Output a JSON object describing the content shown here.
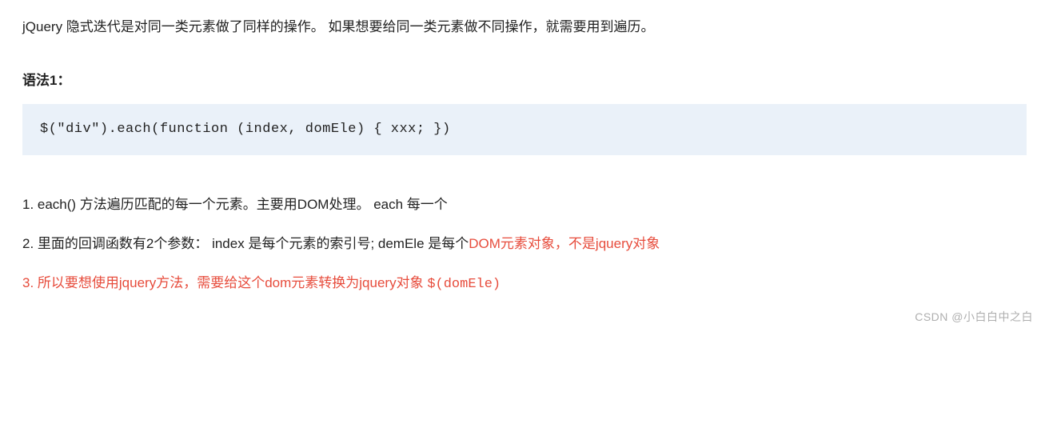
{
  "intro": "jQuery 隐式迭代是对同一类元素做了同样的操作。 如果想要给同一类元素做不同操作，就需要用到遍历。",
  "heading": "语法1：",
  "code": "$(\"div\").each(function (index, domEle) { xxx; })",
  "item1": "1. each() 方法遍历匹配的每一个元素。主要用DOM处理。 each 每一个",
  "item2_prefix": "2. 里面的回调函数有2个参数：  index 是每个元素的索引号; demEle 是每个",
  "item2_red": "DOM元素对象，不是jquery对象",
  "item3_text": "3. 所以要想使用jquery方法，需要给这个dom元素转换为jquery对象 ",
  "item3_code": "$(domEle)",
  "watermark": "CSDN @小白白中之白"
}
